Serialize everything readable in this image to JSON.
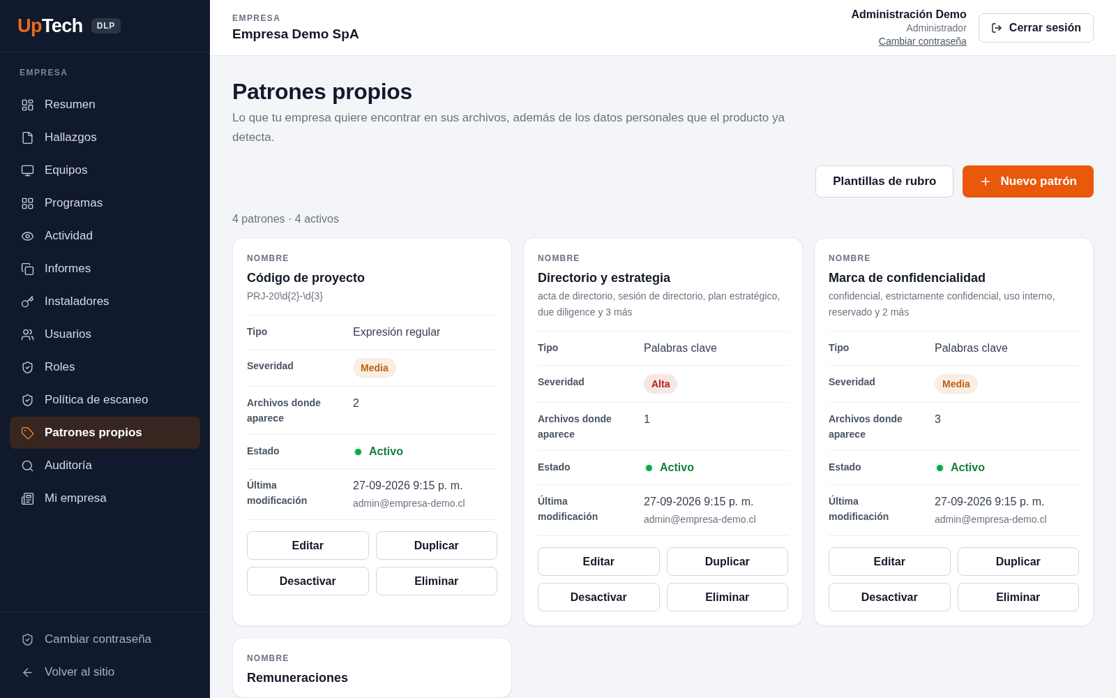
{
  "sidebar": {
    "logo": {
      "accent": "Up",
      "rest": "Tech",
      "badge": "DLP"
    },
    "section_label": "EMPRESA",
    "items": [
      {
        "label": "Resumen",
        "selected": false
      },
      {
        "label": "Hallazgos",
        "selected": false
      },
      {
        "label": "Equipos",
        "selected": false
      },
      {
        "label": "Programas",
        "selected": false
      },
      {
        "label": "Actividad",
        "selected": false
      },
      {
        "label": "Informes",
        "selected": false
      },
      {
        "label": "Instaladores",
        "selected": false
      },
      {
        "label": "Usuarios",
        "selected": false
      },
      {
        "label": "Roles",
        "selected": false
      },
      {
        "label": "Política de escaneo",
        "selected": false
      },
      {
        "label": "Patrones propios",
        "selected": true
      },
      {
        "label": "Auditoría",
        "selected": false
      },
      {
        "label": "Mi empresa",
        "selected": false
      }
    ],
    "footer_items": [
      {
        "label": "Cambiar contraseña"
      },
      {
        "label": "Volver al sitio"
      }
    ]
  },
  "header": {
    "eyebrow": "EMPRESA",
    "company": "Empresa Demo SpA",
    "user": {
      "name": "Administración Demo",
      "role": "Administrador",
      "link": "Cambiar contraseña"
    },
    "logout_button": "Cerrar sesión"
  },
  "page": {
    "title": "Patrones propios",
    "description": "Lo que tu empresa quiere encontrar en sus archivos, además de los datos personales que el producto ya detecta.",
    "secondary_button": "Plantillas de rubro",
    "primary_button": "Nuevo patrón",
    "summary": "4 patrones · 4 activos"
  },
  "patterns": [
    {
      "name_label": "NOMBRE",
      "name": "Código de proyecto",
      "detail": "PRJ-20\\d{2}-\\d{3}",
      "fields": [
        {
          "kind": "text",
          "label": "Tipo",
          "value": "Expresión regular"
        },
        {
          "kind": "badge",
          "label": "Severidad",
          "value": "Media",
          "color": "#c2620c"
        },
        {
          "kind": "text",
          "label": "Archivos donde aparece",
          "value": "2"
        },
        {
          "kind": "status",
          "label": "Estado",
          "value": "Activo",
          "active": true
        },
        {
          "kind": "stamp",
          "label": "Última modificación",
          "value": "27-09-2026 9:15 p. m.",
          "by": "admin@empresa-demo.cl"
        }
      ],
      "actions": [
        "Editar",
        "Duplicar",
        "Desactivar",
        "Eliminar"
      ]
    },
    {
      "name_label": "NOMBRE",
      "name": "Directorio y estrategia",
      "detail": "acta de directorio, sesión de directorio, plan estratégico, due diligence y 3 más",
      "fields": [
        {
          "kind": "text",
          "label": "Tipo",
          "value": "Palabras clave"
        },
        {
          "kind": "badge",
          "label": "Severidad",
          "value": "Alta",
          "color": "#b91c1c"
        },
        {
          "kind": "text",
          "label": "Archivos donde aparece",
          "value": "1"
        },
        {
          "kind": "status",
          "label": "Estado",
          "value": "Activo",
          "active": true
        },
        {
          "kind": "stamp",
          "label": "Última modificación",
          "value": "27-09-2026 9:15 p. m.",
          "by": "admin@empresa-demo.cl"
        }
      ],
      "actions": [
        "Editar",
        "Duplicar",
        "Desactivar",
        "Eliminar"
      ]
    },
    {
      "name_label": "NOMBRE",
      "name": "Marca de confidencialidad",
      "detail": "confidencial, estrictamente confidencial, uso interno, reservado y 2 más",
      "fields": [
        {
          "kind": "text",
          "label": "Tipo",
          "value": "Palabras clave"
        },
        {
          "kind": "badge",
          "label": "Severidad",
          "value": "Media",
          "color": "#c2620c"
        },
        {
          "kind": "text",
          "label": "Archivos donde aparece",
          "value": "3"
        },
        {
          "kind": "status",
          "label": "Estado",
          "value": "Activo",
          "active": true
        },
        {
          "kind": "stamp",
          "label": "Última modificación",
          "value": "27-09-2026 9:15 p. m.",
          "by": "admin@empresa-demo.cl"
        }
      ],
      "actions": [
        "Editar",
        "Duplicar",
        "Desactivar",
        "Eliminar"
      ]
    },
    {
      "name_label": "NOMBRE",
      "name": "Remuneraciones"
    }
  ]
}
